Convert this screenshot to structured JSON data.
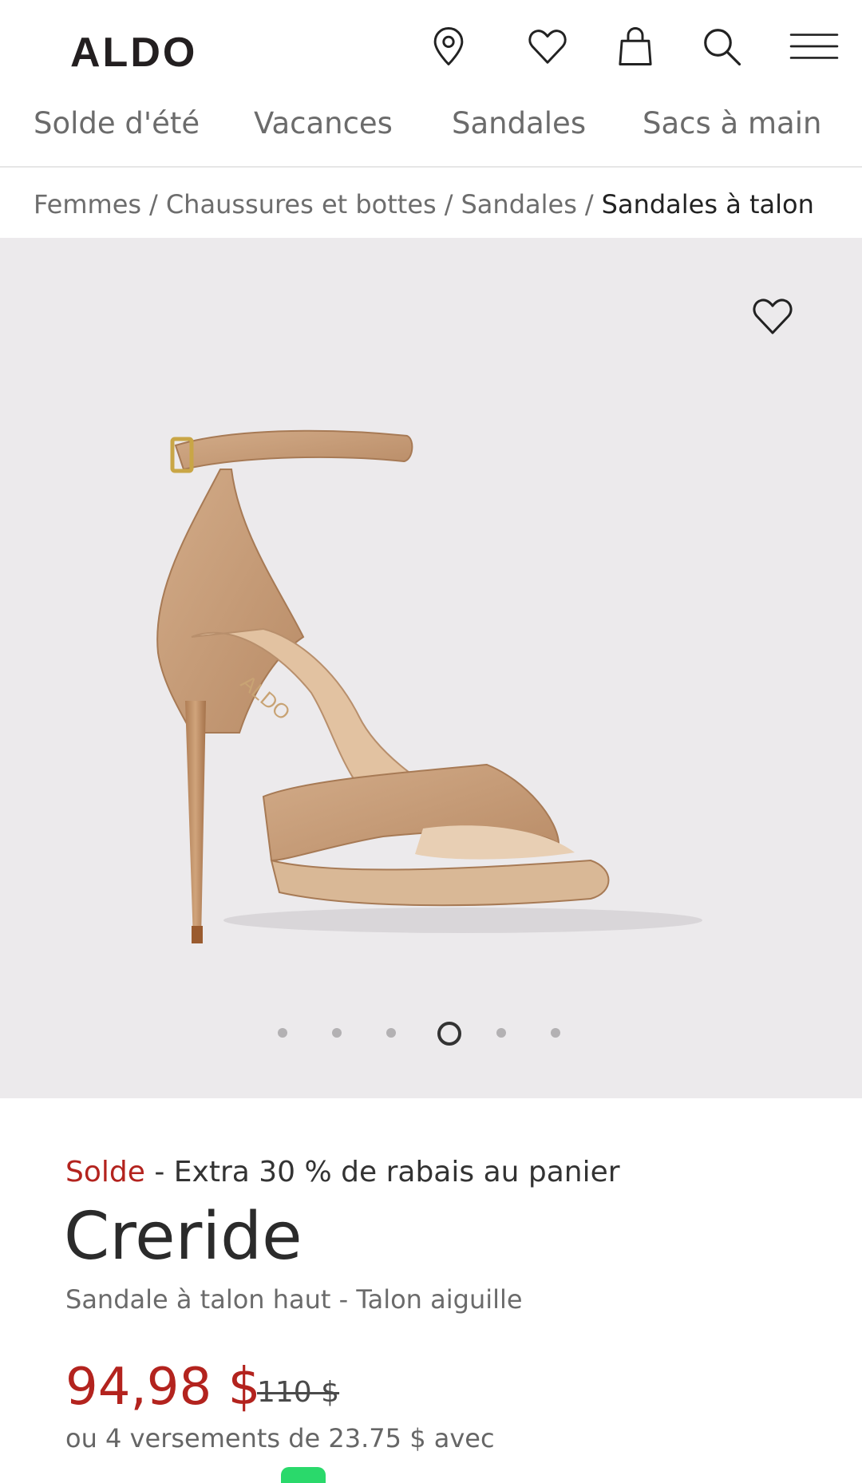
{
  "header": {
    "logo": "ALDO",
    "icons": [
      "location-pin-icon",
      "heart-icon",
      "shopping-bag-icon",
      "search-icon",
      "hamburger-menu-icon"
    ]
  },
  "category_nav": [
    "Solde d'été",
    "Vacances",
    "Sandales",
    "Sacs à main"
  ],
  "breadcrumb": {
    "items": [
      "Femmes",
      "Chaussures et bottes",
      "Sandales"
    ],
    "current": "Sandales à talon",
    "separator": "/"
  },
  "gallery": {
    "slide_count": 6,
    "active_index": 3,
    "favorite_icon": "heart-outline-icon",
    "image_logo_text": "ALDO"
  },
  "product": {
    "sale_label": "Solde",
    "promo_text": "- Extra 30 % de rabais au panier",
    "name": "Creride",
    "description": "Sandale à talon haut - Talon aiguille",
    "price": "94,98 $",
    "original_price": "110 $",
    "installments": "ou 4 versements de 23.75 $ avec"
  },
  "colors": {
    "sale_red": "#b3231e",
    "gallery_bg": "#eceaec",
    "afterpay_green": "#2ad96b"
  }
}
